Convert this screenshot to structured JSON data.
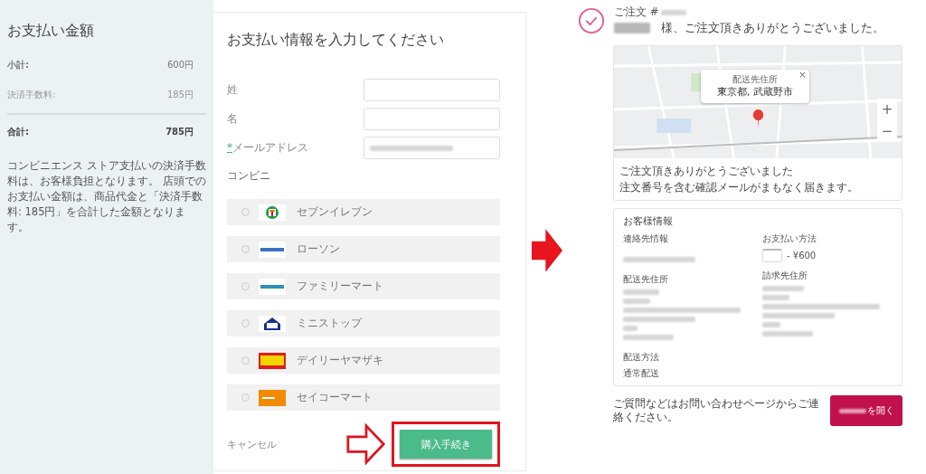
{
  "summary": {
    "title": "お支払い金額",
    "rows": [
      {
        "kind": "subtotal",
        "label": "小計:",
        "value": "600円"
      },
      {
        "kind": "fee",
        "label": "決済手数料:",
        "value": "185円"
      },
      {
        "kind": "total",
        "label": "合計:",
        "value": "785円"
      }
    ],
    "note": "コンビニエンス ストア支払いの決済手数料は、お客様負担となります。 店頭でのお支払い金額は、商品代金と「決済手数料: 185円」を合計した金額となります。"
  },
  "form": {
    "title": "お支払い情報を入力してください",
    "required_mark": "*",
    "fields": [
      {
        "label": "姓",
        "required": false,
        "filled": false
      },
      {
        "label": "名",
        "required": false,
        "filled": false
      },
      {
        "label": "メールアドレス",
        "required": true,
        "filled": true
      }
    ],
    "store_label": "コンビニ",
    "stores": [
      {
        "kind": "seven",
        "name": "セブンイレブン",
        "selected": false
      },
      {
        "kind": "lawson",
        "name": "ローソン",
        "selected": false
      },
      {
        "kind": "family",
        "name": "ファミリーマート",
        "selected": false
      },
      {
        "kind": "ministop",
        "name": "ミニストップ",
        "selected": false
      },
      {
        "kind": "daily",
        "name": "デイリーヤマザキ",
        "selected": false
      },
      {
        "kind": "seico",
        "name": "セイコーマート",
        "selected": false
      }
    ],
    "cancel": "キャンセル",
    "submit": "購入手続き"
  },
  "confirmation": {
    "order_label": "ご注文 #",
    "thanks_heading": "様、ご注文頂きありがとうございました。",
    "map_popup": {
      "title": "配送先住所",
      "address": "東京都, 武蔵野市",
      "close": "×"
    },
    "map_zoom": [
      "+",
      "−"
    ],
    "thanks_title": "ご注文頂きありがとうございました",
    "thanks_text": "注文番号を含む確認メールがまもなく届きます。",
    "customer": {
      "title": "お客様情報",
      "contact_label": "連絡先情報",
      "payment_label": "お支払い方法",
      "payment_value": "- ¥600",
      "shipping_label": "配送先住所",
      "billing_label": "請求先住所",
      "method_label": "配送方法",
      "method_value": "通常配送"
    },
    "footer_text": "ご質問などはお問い合わせページからご連絡ください。",
    "open_button": "を開く"
  }
}
